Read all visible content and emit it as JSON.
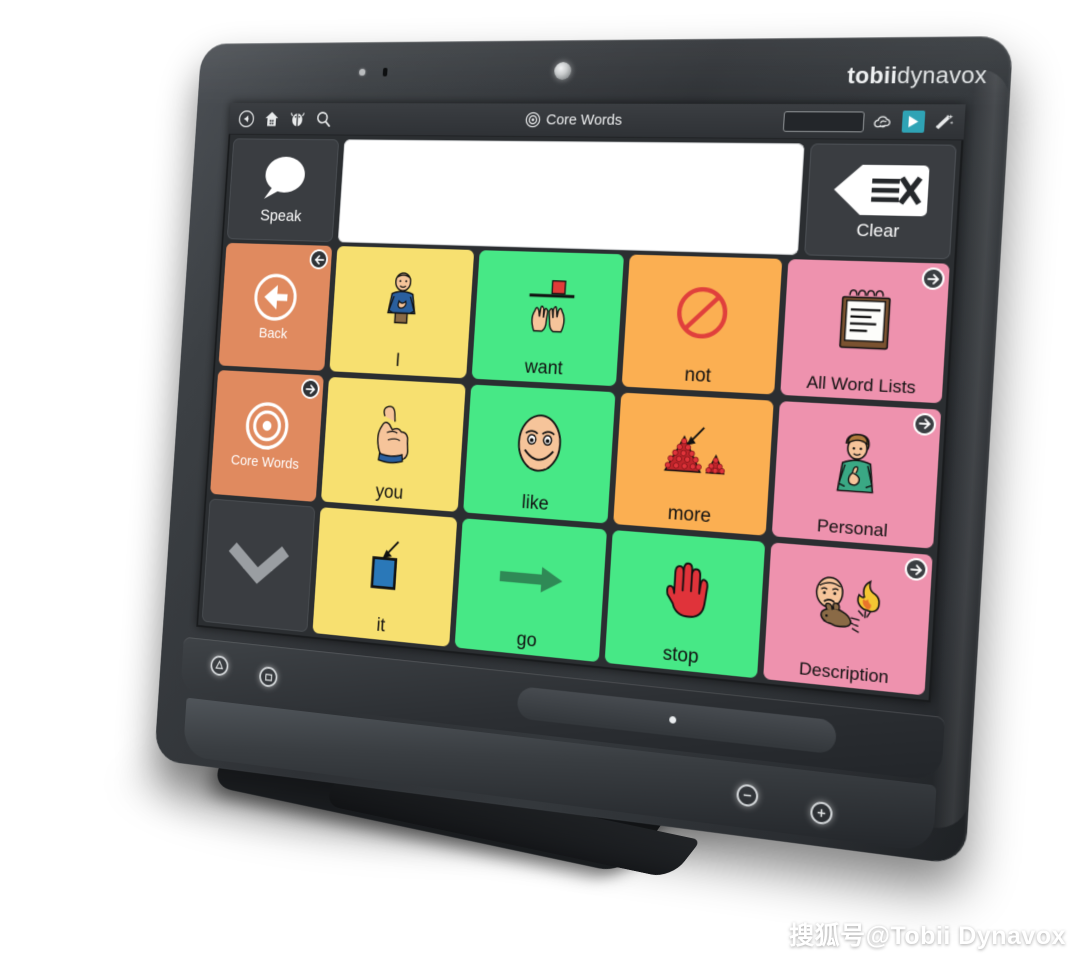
{
  "device": {
    "brand_bold": "tobii",
    "brand_light": "dynavox"
  },
  "watermark": "搜狐号@Tobii Dynavox",
  "toolbar": {
    "icons": [
      {
        "name": "back-icon",
        "label": "Back"
      },
      {
        "name": "home-icon",
        "label": "Home"
      },
      {
        "name": "bug-icon",
        "label": "Debug"
      },
      {
        "name": "search-icon",
        "label": "Search"
      }
    ],
    "title": "Core Words",
    "title_icon": "target-icon",
    "right_icons": [
      {
        "name": "text-field",
        "label": ""
      },
      {
        "name": "cloud-sync-icon",
        "label": "Sync"
      },
      {
        "name": "play-icon",
        "label": "Play"
      },
      {
        "name": "magic-wand-icon",
        "label": "Edit"
      }
    ],
    "accent_play": "#2fa3b5"
  },
  "message_bar": {
    "speak_label": "Speak",
    "speak_icon": "speech-bubble-icon",
    "text_value": "",
    "text_placeholder": "",
    "clear_label": "Clear",
    "clear_icon": "clear-tag-icon"
  },
  "nav_column": [
    {
      "label": "Back",
      "icon": "circle-left-arrow-icon",
      "badge": "left-arrow",
      "color": "#e08a5f"
    },
    {
      "label": "Core Words",
      "icon": "target-icon",
      "badge": "right-arrow",
      "color": "#e08a5f"
    },
    {
      "label": "",
      "icon": "chevron-down-icon",
      "badge": "",
      "color": "#3a3d41"
    }
  ],
  "grid": {
    "columns": 4,
    "rows": 3,
    "cells": [
      {
        "label": "I",
        "symbol": "person-pointing-self-icon",
        "color": "#f7e070",
        "badge": ""
      },
      {
        "label": "want",
        "symbol": "hands-reaching-block-icon",
        "color": "#47e886",
        "badge": ""
      },
      {
        "label": "not",
        "symbol": "prohibited-sign-icon",
        "color": "#fbaf52",
        "badge": ""
      },
      {
        "label": "All Word Lists",
        "symbol": "notepad-icon",
        "color": "#ee92ae",
        "badge": "right-arrow"
      },
      {
        "label": "you",
        "symbol": "pointing-hand-icon",
        "color": "#f7e070",
        "badge": ""
      },
      {
        "label": "like",
        "symbol": "smiling-face-icon",
        "color": "#47e886",
        "badge": ""
      },
      {
        "label": "more",
        "symbol": "pile-of-berries-icon",
        "color": "#fbaf52",
        "badge": ""
      },
      {
        "label": "Personal",
        "symbol": "person-thumb-chest-icon",
        "color": "#ee92ae",
        "badge": "right-arrow"
      },
      {
        "label": "it",
        "symbol": "blue-square-arrow-icon",
        "color": "#f7e070",
        "badge": ""
      },
      {
        "label": "go",
        "symbol": "right-arrow-icon",
        "color": "#47e886",
        "badge": ""
      },
      {
        "label": "stop",
        "symbol": "red-hand-icon",
        "color": "#47e886",
        "badge": ""
      },
      {
        "label": "Description",
        "symbol": "face-fire-rabbit-icon",
        "color": "#ee92ae",
        "badge": "right-arrow"
      }
    ]
  },
  "hardware_buttons": [
    {
      "name": "power-button",
      "glyph": "⏻"
    },
    {
      "name": "home-button",
      "glyph": "◻"
    },
    {
      "name": "volume-down-button",
      "glyph": "−"
    },
    {
      "name": "volume-up-button",
      "glyph": "+"
    }
  ],
  "palette": {
    "yellow": "#f7e070",
    "green": "#47e886",
    "orange": "#fbaf52",
    "pink": "#ee92ae",
    "nav_orange": "#e08a5f",
    "screen_bg": "#2b2e31",
    "shell": "#34383c"
  }
}
